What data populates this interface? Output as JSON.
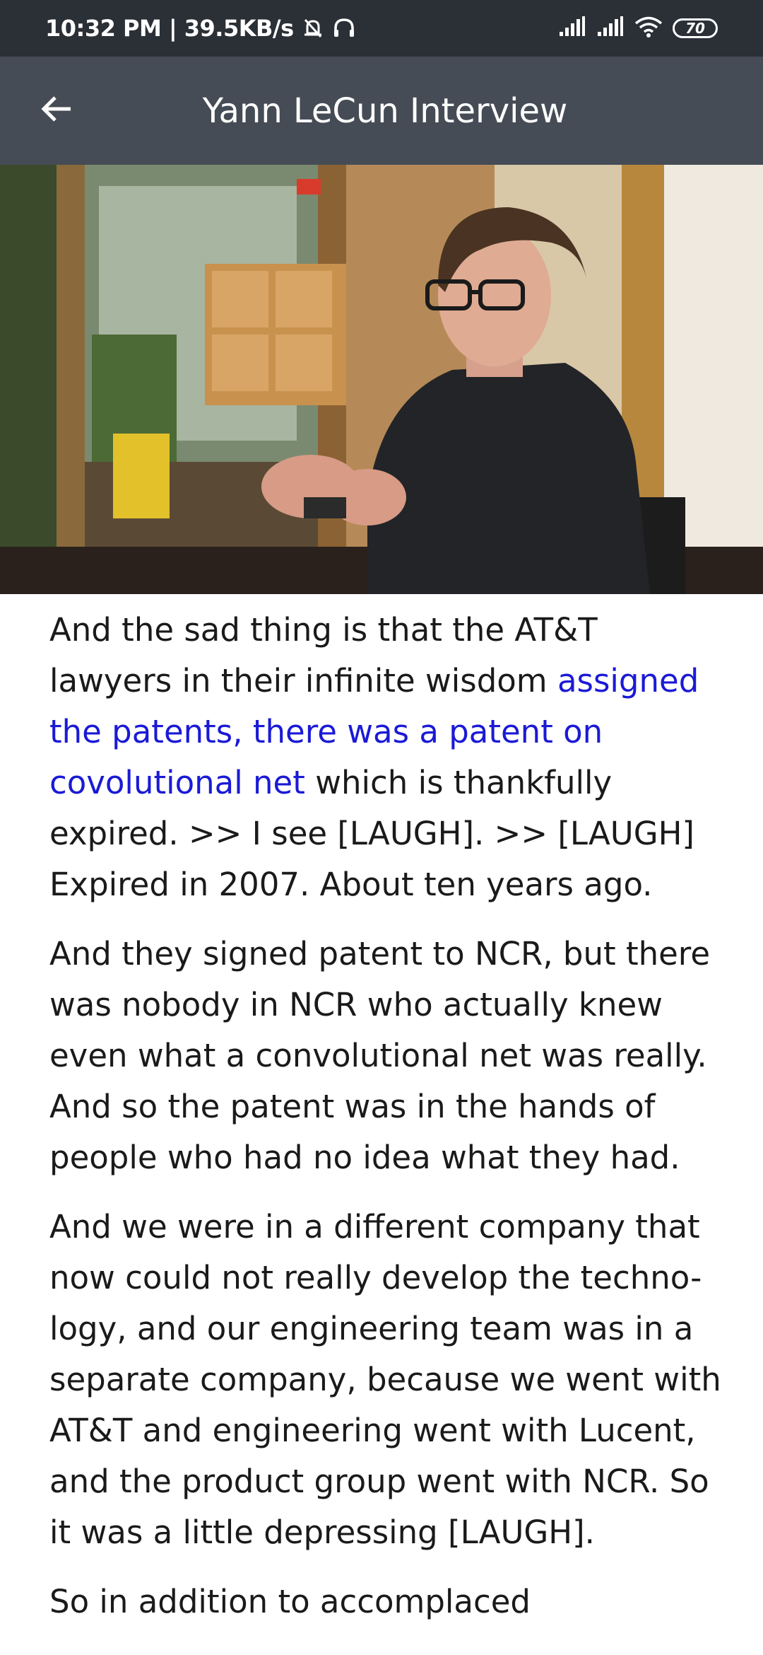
{
  "status_bar": {
    "time_speed": "10:32 PM | 39.5KB/s",
    "battery": "70",
    "icons": [
      "mute-icon",
      "headphones-icon",
      "signal-icon",
      "signal-icon",
      "wifi-icon",
      "battery-icon"
    ]
  },
  "app_bar": {
    "title": "Yann LeCun Interview",
    "back_icon": "back-arrow-icon"
  },
  "transcript": {
    "p1_before": "And the sad thing is that the AT&T lawyers in their infinite wisdom ",
    "p1_highlight": "assigned the patents, there was a patent on covolutional net",
    "p1_after": " which is thankfully expired.  >> I see [LAUGH]. >> [LAUGH] Expired in 2007. About ten years ago.",
    "p2": "And they signed patent to NCR, but there was nobody in NCR who actually knew even what a convolutional net was really. And so the patent was in the hands of people who had no idea what they had.",
    "p3": "And we were in a different company that now could not really develop the techno-logy, and our engineering team was in a separate company, because we went with AT&T and engineering went with Lucent, and the product group went with NCR. So it was a little depressing [LAUGH].",
    "p4_partial": "So in addition to accomplaced"
  },
  "colors": {
    "status_bar": "#2b2f36",
    "app_bar": "#464c55",
    "highlight": "#1a1ad6",
    "text": "#1a1a1a"
  }
}
